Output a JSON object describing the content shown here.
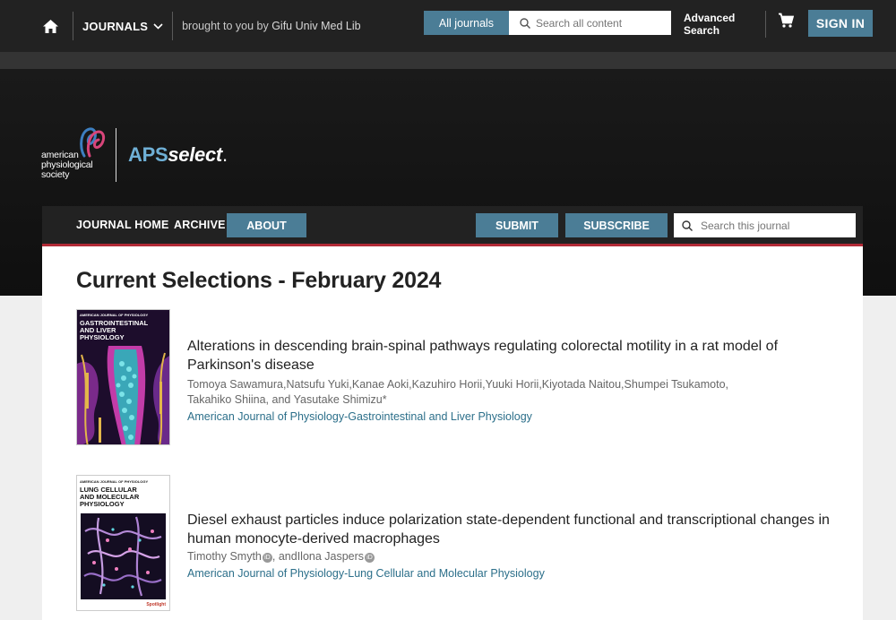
{
  "topbar": {
    "journals_label": "JOURNALS",
    "brought_prefix": "brought to you by",
    "institution": "Gifu Univ Med Lib",
    "all_journals_label": "All journals",
    "search_placeholder": "Search all content",
    "advanced_line1": "Advanced",
    "advanced_line2": "Search",
    "signin_label": "SIGN IN"
  },
  "branding": {
    "society_line1": "american",
    "society_line2": "physiological",
    "society_line3": "society",
    "product_aps": "APS",
    "product_select": "select",
    "product_dot": "."
  },
  "journal_nav": {
    "home_label": "JOURNAL HOME",
    "archive_label": "ARCHIVE",
    "about_label": "ABOUT",
    "submit_label": "SUBMIT",
    "subscribe_label": "SUBSCRIBE",
    "search_placeholder": "Search this journal"
  },
  "main": {
    "title": "Current Selections - February 2024",
    "articles": [
      {
        "cover_header": "AMERICAN JOURNAL OF PHYSIOLOGY",
        "cover_title_1": "GASTROINTESTINAL",
        "cover_title_2": "AND LIVER",
        "cover_title_3": "PHYSIOLOGY",
        "title": "Alterations in descending brain-spinal pathways regulating colorectal motility in a rat model of Parkinson's disease",
        "authors_line1": "Tomoya Sawamura,Natsufu Yuki,Kanae Aoki,Kazuhiro Horii,Yuuki Horii,Kiyotada Naitou,Shumpei Tsukamoto,",
        "authors_line2": "Takahiko Shiina, and Yasutake Shimizu*",
        "journal": "American Journal of Physiology-Gastrointestinal and Liver Physiology"
      },
      {
        "cover_header": "AMERICAN JOURNAL OF PHYSIOLOGY",
        "cover_title_1": "LUNG CELLULAR",
        "cover_title_2": "AND MOLECULAR",
        "cover_title_3": "PHYSIOLOGY",
        "cover_badge": "Spotlight",
        "title": "Diesel exhaust particles induce polarization state-dependent functional and transcriptional changes in human monocyte-derived macrophages",
        "author1": "Timothy Smyth",
        "author_sep": ", and",
        "author2": "Ilona Jaspers",
        "journal": "American Journal of Physiology-Lung Cellular and Molecular Physiology"
      }
    ]
  },
  "icons": {
    "home": "home-icon",
    "chevron": "chevron-down-icon",
    "search": "search-icon",
    "cart": "cart-icon",
    "orcid": "orcid-icon"
  },
  "colors": {
    "accent_button": "#4b7d96",
    "nav_underline": "#b12a36",
    "journal_link": "#2c6f8a"
  }
}
